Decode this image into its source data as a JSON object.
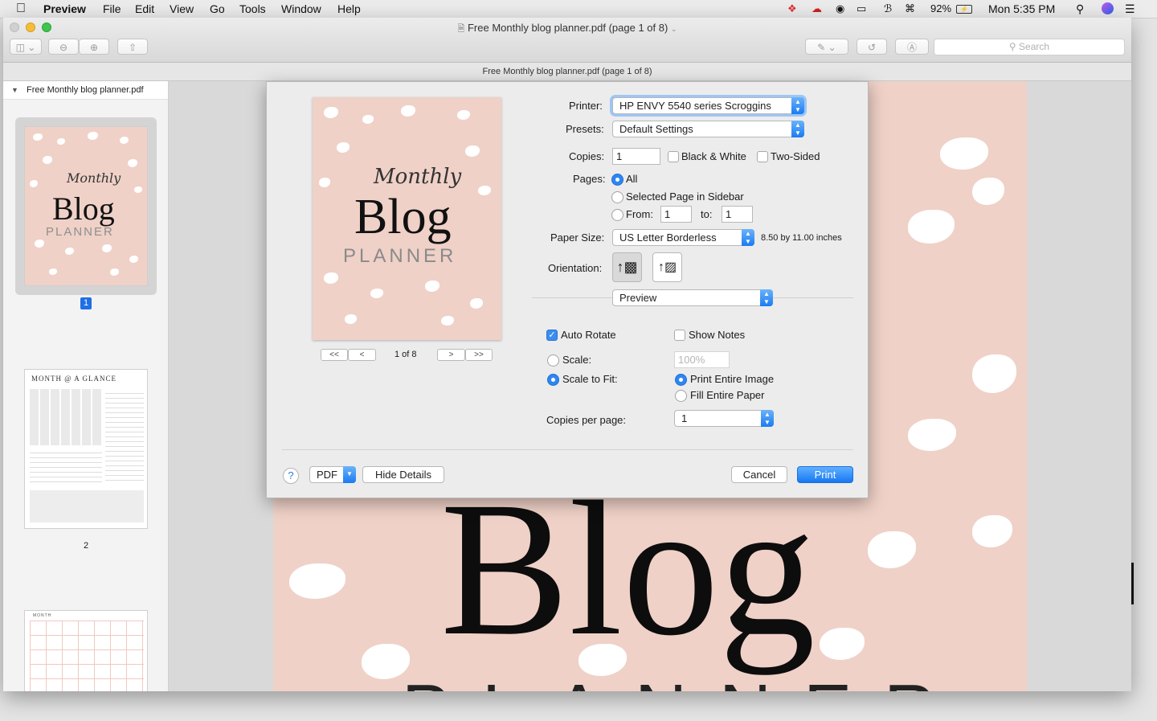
{
  "menubar": {
    "app": "Preview",
    "items": [
      "File",
      "Edit",
      "View",
      "Go",
      "Tools",
      "Window",
      "Help"
    ],
    "battery": "92%",
    "clock": "Mon 5:35 PM"
  },
  "window": {
    "title": "Free Monthly blog planner.pdf (page 1 of 8)",
    "doc_title": "Free Monthly blog planner.pdf (page 1 of 8)",
    "search_placeholder": "Search"
  },
  "sidebar": {
    "file_name": "Free Monthly blog planner.pdf",
    "pages": [
      {
        "number": "1",
        "selected": true
      },
      {
        "number": "2",
        "selected": false
      }
    ],
    "cover_script": "Monthly",
    "cover_title": "Blog",
    "cover_sub": "PLANNER",
    "page2_title": "MONTH @ A GLANCE",
    "page3_title": "MONTH"
  },
  "print_dialog": {
    "preview_nav": {
      "first": "<<",
      "prev": "<",
      "page_indicator": "1 of 8",
      "next": ">",
      "last": ">>"
    },
    "printer_label": "Printer:",
    "printer": "HP ENVY 5540 series Scroggins",
    "presets_label": "Presets:",
    "presets": "Default Settings",
    "copies_label": "Copies:",
    "copies": "1",
    "black_white": "Black & White",
    "two_sided": "Two-Sided",
    "pages_label": "Pages:",
    "pages_all": "All",
    "pages_selected": "Selected Page in Sidebar",
    "pages_from": "From:",
    "from_value": "1",
    "pages_to": "to:",
    "to_value": "1",
    "paper_size_label": "Paper Size:",
    "paper_size": "US Letter Borderless",
    "paper_dims": "8.50 by 11.00 inches",
    "orientation_label": "Orientation:",
    "section_popup": "Preview",
    "auto_rotate": "Auto Rotate",
    "show_notes": "Show Notes",
    "scale_label": "Scale:",
    "scale_value": "100%",
    "scale_to_fit": "Scale to Fit:",
    "print_entire_image": "Print Entire Image",
    "fill_entire_paper": "Fill Entire Paper",
    "copies_per_page_label": "Copies per page:",
    "copies_per_page": "1",
    "help": "?",
    "pdf": "PDF",
    "hide_details": "Hide Details",
    "cancel": "Cancel",
    "print": "Print"
  },
  "background_page": {
    "title": "Blog",
    "subtitle": "PLANNER"
  },
  "colors": {
    "accent": "#1677f3",
    "page_pink": "#efd1c7"
  }
}
